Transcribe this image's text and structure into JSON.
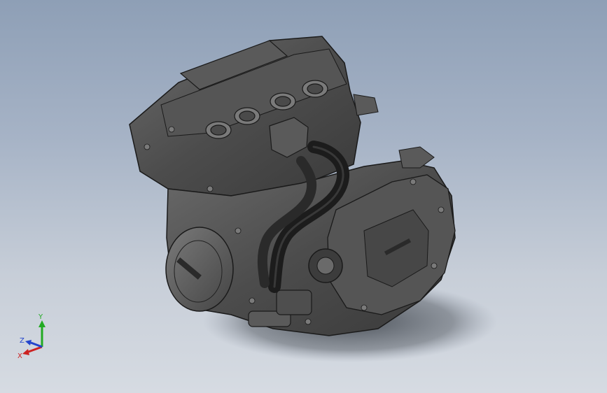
{
  "viewport": {
    "background_top": "#8e9fb6",
    "background_bottom": "#d6dbe2"
  },
  "model": {
    "part": "engine-assembly",
    "body_color": "#4a4a4a",
    "edge_color": "#1a1a1a",
    "hose_color": "#1c1c1c",
    "shadow_color": "#5a6068"
  },
  "triad": {
    "x_label": "X",
    "y_label": "Y",
    "z_label": "Z",
    "x_color": "#cc2222",
    "y_color": "#22aa22",
    "z_color": "#2244cc"
  }
}
